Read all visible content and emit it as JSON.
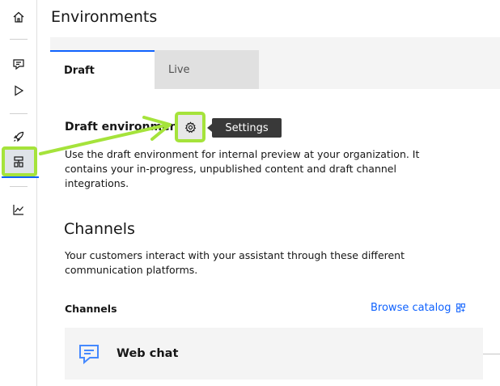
{
  "header": {
    "title": "Environments"
  },
  "tabs": [
    {
      "label": "Draft",
      "active": true
    },
    {
      "label": "Live",
      "active": false
    }
  ],
  "draft_section": {
    "heading": "Draft environment",
    "description": "Use the draft environment for internal preview at your organization. It contains your in-progress, unpublished content and draft channel integrations.",
    "settings_tooltip": "Settings"
  },
  "channels_section": {
    "heading": "Channels",
    "description": "Your customers interact with your assistant through these different communication platforms.",
    "subheading": "Channels",
    "browse_label": "Browse catalog",
    "cards": [
      {
        "label": "Web chat",
        "icon": "chat-icon"
      }
    ]
  },
  "rail": {
    "icons": [
      "home-icon",
      "chat-icon",
      "play-icon",
      "rocket-icon",
      "environments-icon",
      "analytics-icon"
    ]
  },
  "colors": {
    "accent": "#0f62fe",
    "highlight": "#a5e33b",
    "tooltip": "#393939"
  }
}
